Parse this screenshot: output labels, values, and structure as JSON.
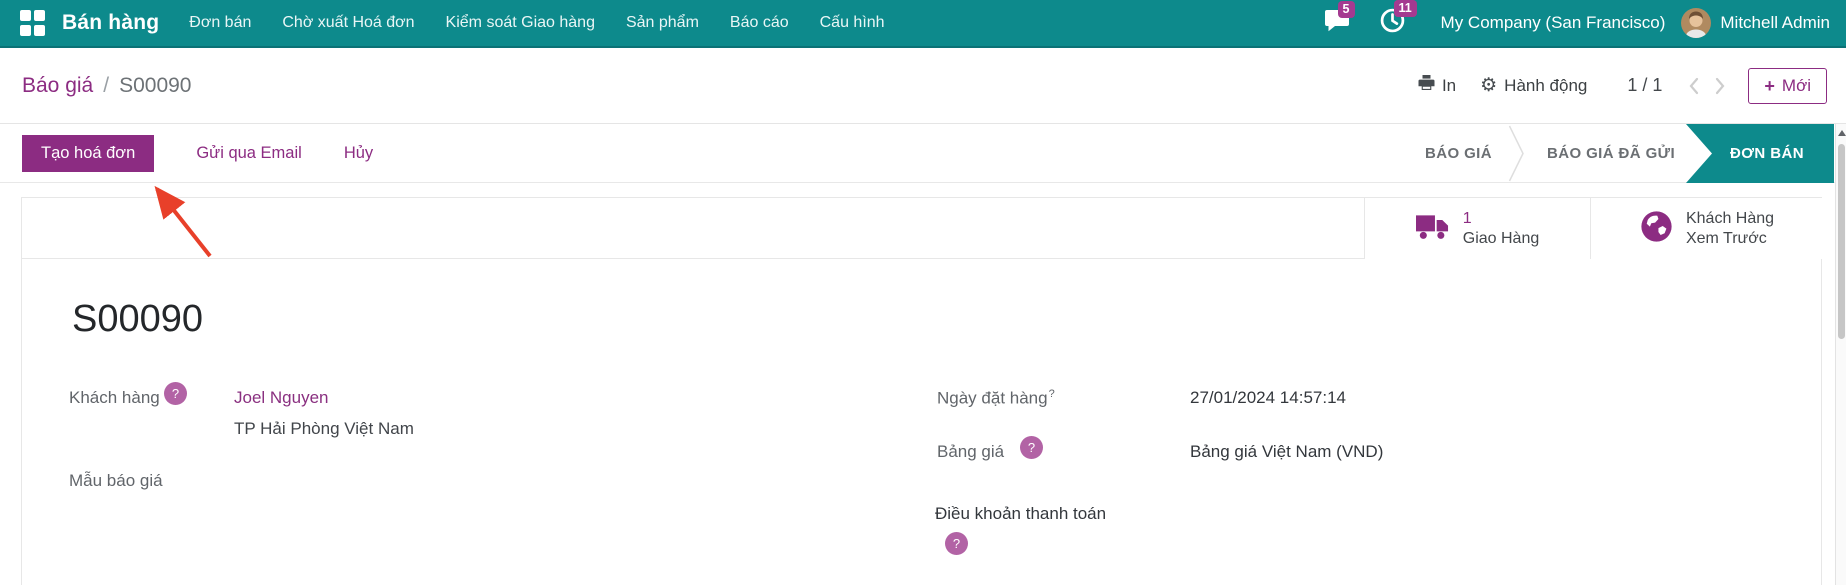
{
  "colors": {
    "topbar_teal": "#0D8A8C",
    "primary_purple": "#8C2C82",
    "badge_magenta": "#A43A90",
    "help_circle_purple": "#B263A5",
    "stage_active_teal": "#0D8A8C",
    "annotation_red": "#E8402A"
  },
  "topbar": {
    "app_name": "Bán hàng",
    "menu": [
      "Đơn bán",
      "Chờ xuất Hoá đơn",
      "Kiểm soát Giao hàng",
      "Sản phẩm",
      "Báo cáo",
      "Cấu hình"
    ],
    "messages_badge": "5",
    "activities_badge": "11",
    "company": "My Company (San Francisco)",
    "user": "Mitchell Admin"
  },
  "control_panel": {
    "breadcrumb_parent": "Báo giá",
    "breadcrumb_separator": "/",
    "breadcrumb_current": "S00090",
    "print_label": "In",
    "action_label": "Hành động",
    "pager": "1 / 1",
    "new_button_plus": "+",
    "new_button_label": "Mới"
  },
  "status_bar": {
    "create_invoice_button": "Tạo hoá đơn",
    "send_email_button": "Gửi qua Email",
    "cancel_button": "Hủy",
    "stages": [
      "BÁO GIÁ",
      "BÁO GIÁ ĐÃ GỬI",
      "ĐƠN BÁN"
    ],
    "active_stage": "ĐƠN BÁN"
  },
  "smart_buttons": [
    {
      "icon": "truck-icon",
      "value": "1",
      "label": "Giao Hàng"
    },
    {
      "icon": "globe-icon",
      "value": "Khách Hàng",
      "label": "Xem Trước"
    }
  ],
  "form": {
    "title": "S00090",
    "help_mark": "?",
    "customer": {
      "label": "Khách hàng",
      "name": "Joel Nguyen",
      "address": "TP Hải Phòng Việt Nam"
    },
    "quotation_template": {
      "label": "Mẫu báo giá",
      "value": ""
    },
    "order_date": {
      "label": "Ngày đặt hàng",
      "value": "27/01/2024 14:57:14"
    },
    "pricelist": {
      "label": "Bảng giá",
      "value": "Bảng giá Việt Nam (VND)"
    },
    "payment_terms": {
      "label": "Điều khoản thanh toán",
      "value": ""
    }
  }
}
